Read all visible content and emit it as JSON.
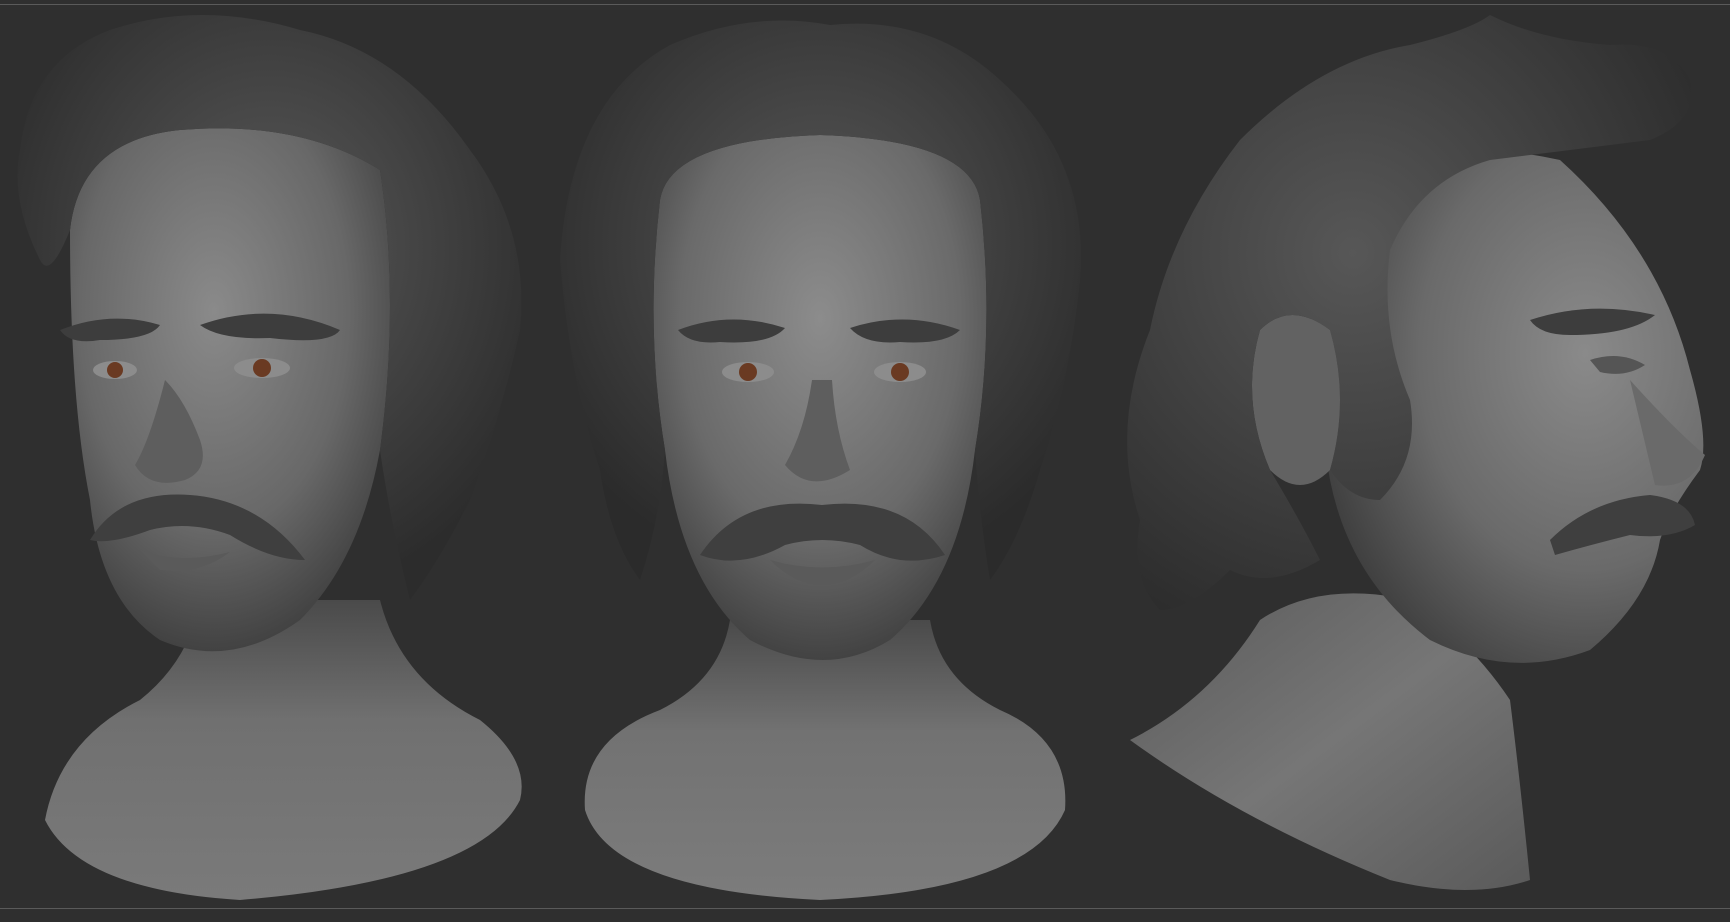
{
  "scene": {
    "background_color": "#2f2f2f",
    "material_color": "#6b6b6b",
    "hair_color": "#4a4a4a",
    "iris_color": "#6a3a22",
    "views": [
      {
        "name": "three-quarter-front",
        "icon": "sculpt-head-34"
      },
      {
        "name": "front",
        "icon": "sculpt-head-front"
      },
      {
        "name": "right-profile",
        "icon": "sculpt-head-profile"
      }
    ]
  }
}
